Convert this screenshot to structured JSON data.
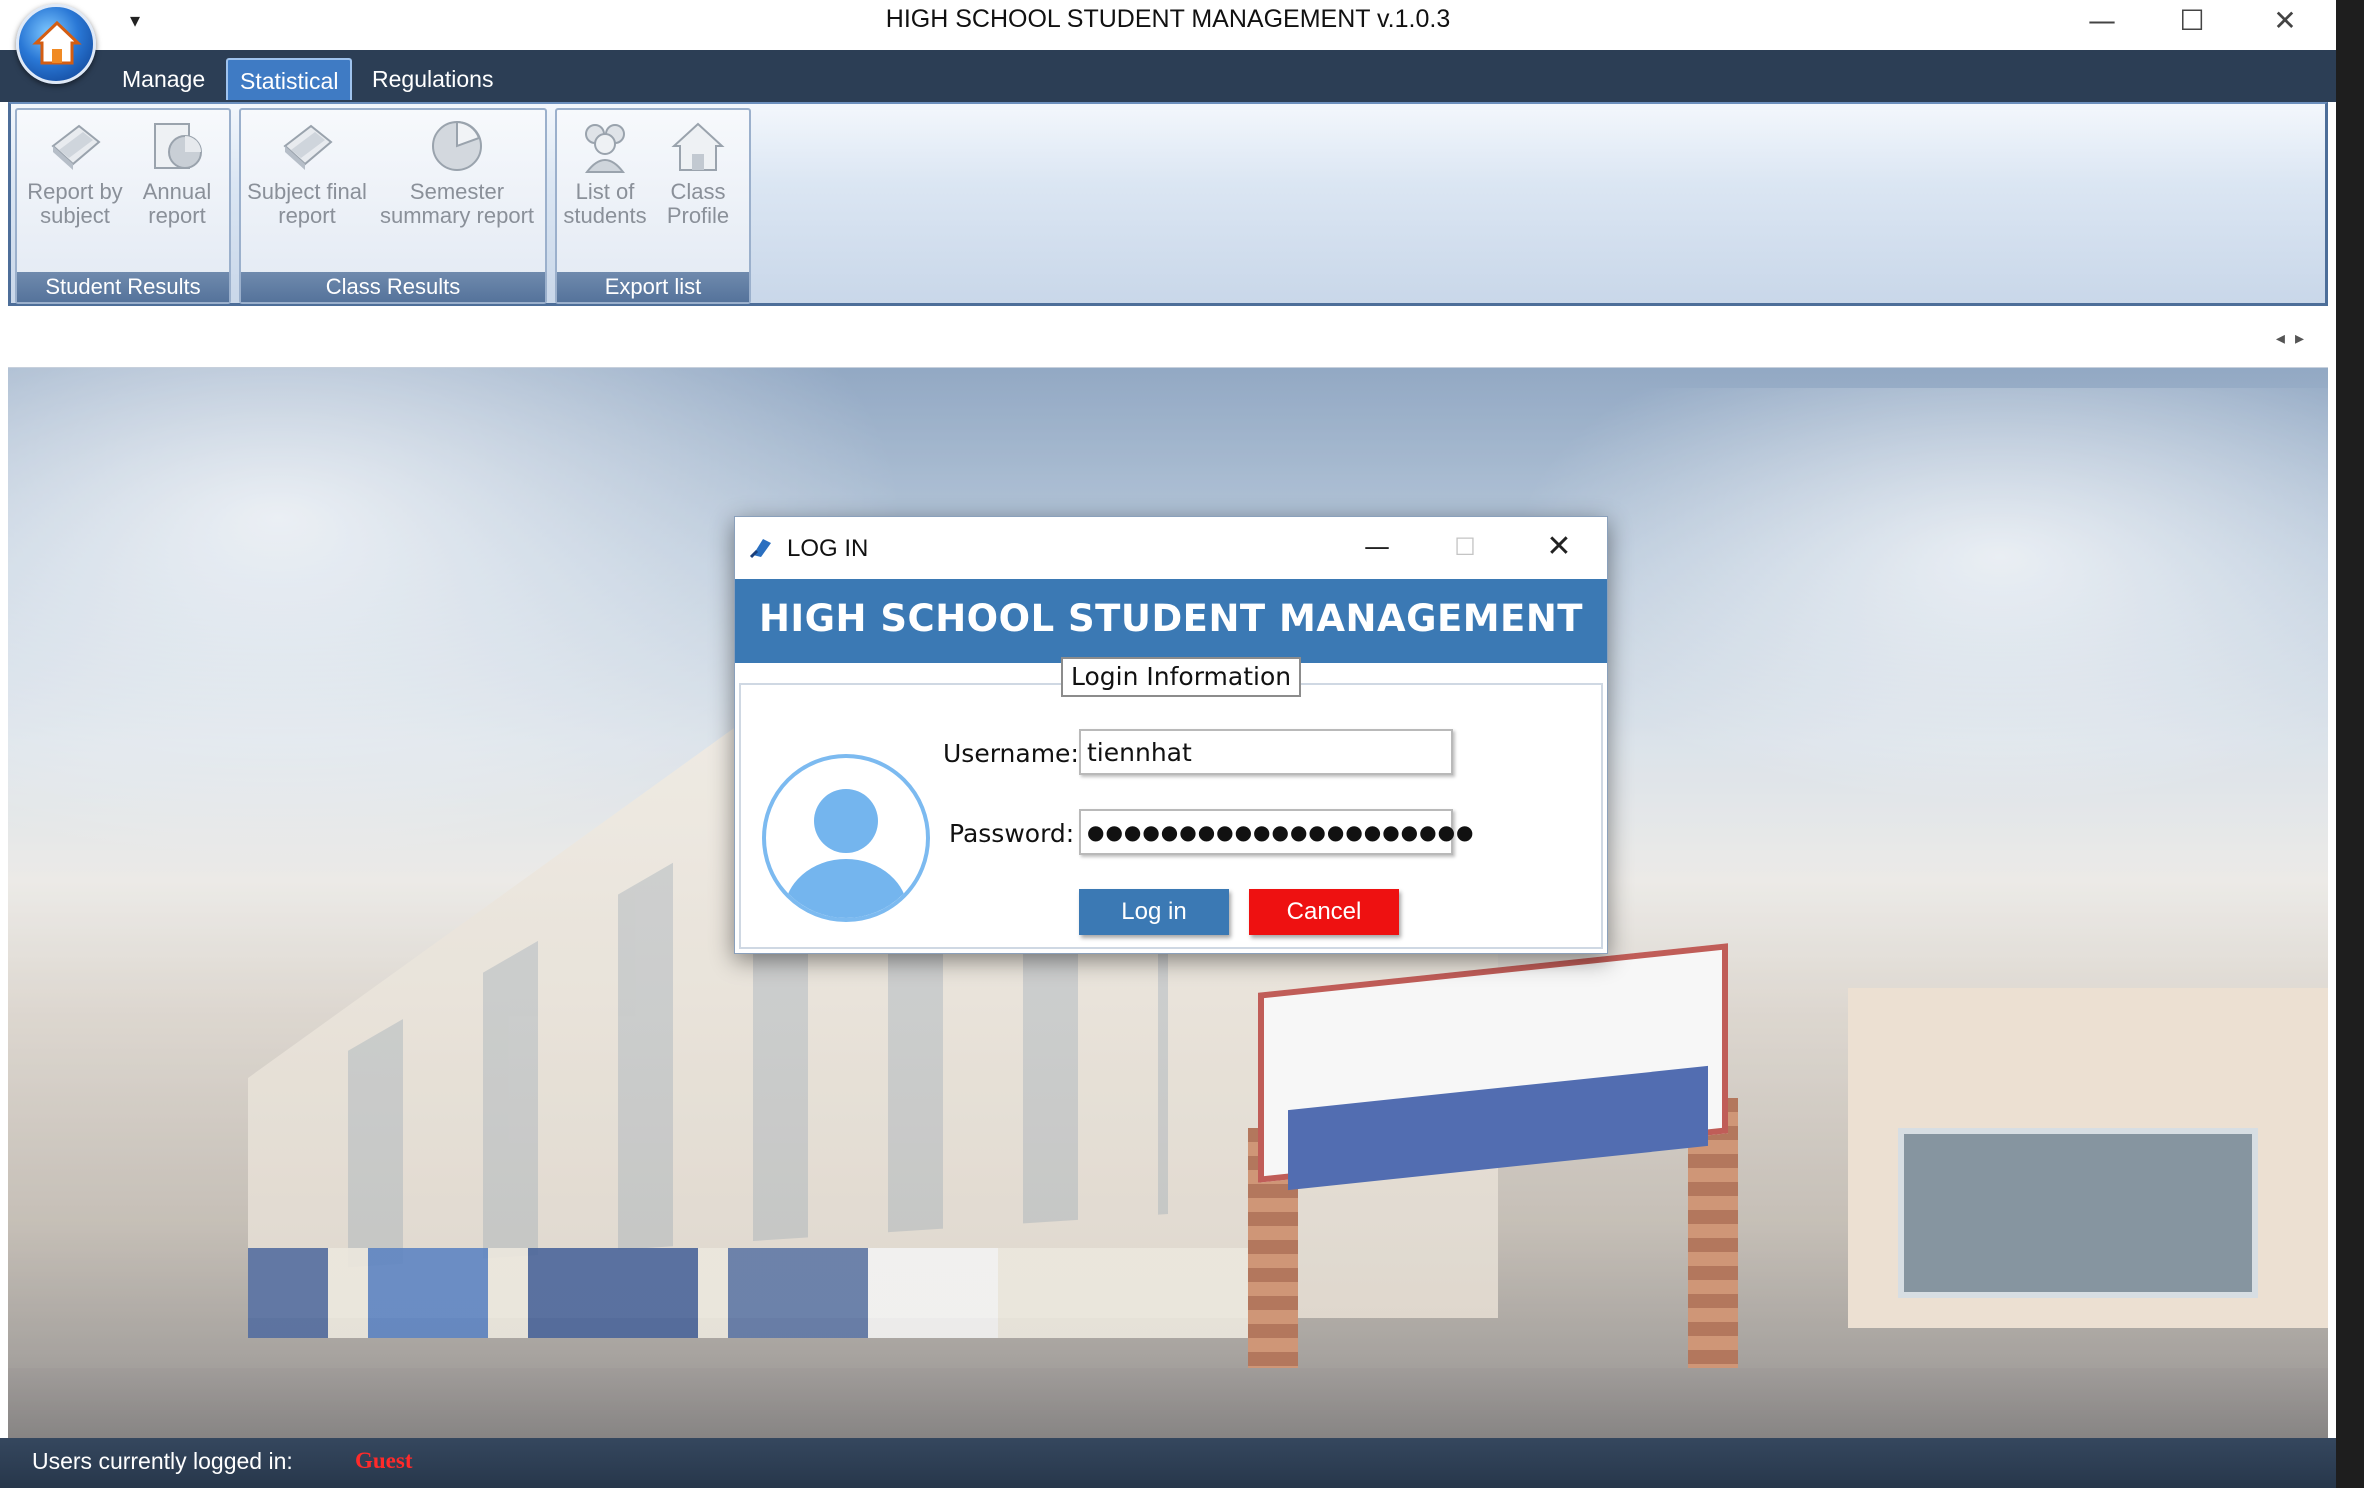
{
  "app": {
    "title": "HIGH SCHOOL STUDENT MANAGEMENT v.1.0.3",
    "quick_access_glyph": "▾",
    "window_controls": {
      "minimize": "—",
      "maximize": "☐",
      "close": "✕"
    }
  },
  "ribbon": {
    "tabs": [
      {
        "label": "Manage"
      },
      {
        "label": "Statistical"
      },
      {
        "label": "Regulations"
      }
    ],
    "groups": [
      {
        "label": "Student Results",
        "buttons": [
          {
            "label": "Report by\nsubject",
            "icon": "report-document-icon"
          },
          {
            "label": "Annual\nreport",
            "icon": "pie-report-icon"
          }
        ]
      },
      {
        "label": "Class Results",
        "buttons": [
          {
            "label": "Subject final\nreport",
            "icon": "report-document-icon"
          },
          {
            "label": "Semester\nsummary report",
            "icon": "pie-chart-icon"
          }
        ]
      },
      {
        "label": "Export list",
        "buttons": [
          {
            "label": "List of\nstudents",
            "icon": "users-icon"
          },
          {
            "label": "Class\nProfile",
            "icon": "house-icon"
          }
        ]
      }
    ],
    "scroll_arrows": "◂▸"
  },
  "status": {
    "label": "Users currently logged in:",
    "user": "Guest",
    "user_color": "#ff2a2a"
  },
  "login": {
    "title": "LOG IN",
    "header": "HIGH SCHOOL STUDENT MANAGEMENT",
    "group_caption": "Login Information",
    "username_label": "Username:",
    "username_value": "tiennhat",
    "password_label": "Password:",
    "password_value": "●●●●●●●●●●●●●●●●●●●●●",
    "login_button": "Log in",
    "cancel_button": "Cancel",
    "controls": {
      "minimize": "—",
      "maximize": "☐",
      "close": "✕"
    },
    "header_color": "#3b79b4",
    "cancel_color": "#ee1111"
  }
}
